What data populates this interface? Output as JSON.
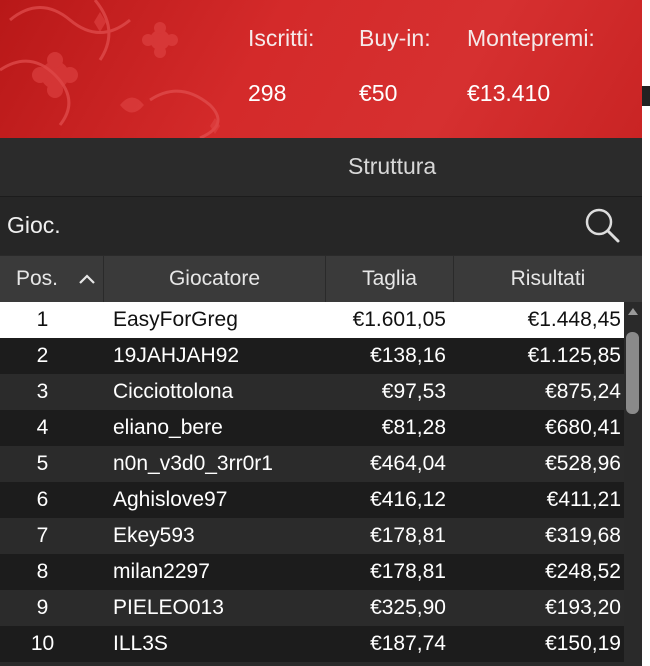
{
  "banner": {
    "registered_label": "Iscritti:",
    "registered_value": "298",
    "buyin_label": "Buy-in:",
    "buyin_value": "€50",
    "prize_label": "Montepremi:",
    "prize_value": "€13.410"
  },
  "tabs": {
    "active": "Struttura"
  },
  "search": {
    "placeholder": "Gioc."
  },
  "table": {
    "headers": {
      "pos": "Pos.",
      "player": "Giocatore",
      "chips": "Taglia",
      "results": "Risultati"
    },
    "rows": [
      {
        "pos": "1",
        "player": "EasyForGreg",
        "chips": "€1.601,05",
        "prize": "€1.448,45"
      },
      {
        "pos": "2",
        "player": "19JAHJAH92",
        "chips": "€138,16",
        "prize": "€1.125,85"
      },
      {
        "pos": "3",
        "player": "Cicciottolona",
        "chips": "€97,53",
        "prize": "€875,24"
      },
      {
        "pos": "4",
        "player": "eliano_bere",
        "chips": "€81,28",
        "prize": "€680,41"
      },
      {
        "pos": "5",
        "player": "n0n_v3d0_3rr0r1",
        "chips": "€464,04",
        "prize": "€528,96"
      },
      {
        "pos": "6",
        "player": "Aghislove97",
        "chips": "€416,12",
        "prize": "€411,21"
      },
      {
        "pos": "7",
        "player": "Ekey593",
        "chips": "€178,81",
        "prize": "€319,68"
      },
      {
        "pos": "8",
        "player": "milan2297",
        "chips": "€178,81",
        "prize": "€248,52"
      },
      {
        "pos": "9",
        "player": "PIELEO013",
        "chips": "€325,90",
        "prize": "€193,20"
      },
      {
        "pos": "10",
        "player": "ILL3S",
        "chips": "€187,74",
        "prize": "€150,19"
      }
    ]
  },
  "colors": {
    "banner_red": "#d42a2a",
    "selected_row": "#ffffff",
    "row_dark": "#1c1c1c",
    "row_light": "#2b2b2b"
  }
}
